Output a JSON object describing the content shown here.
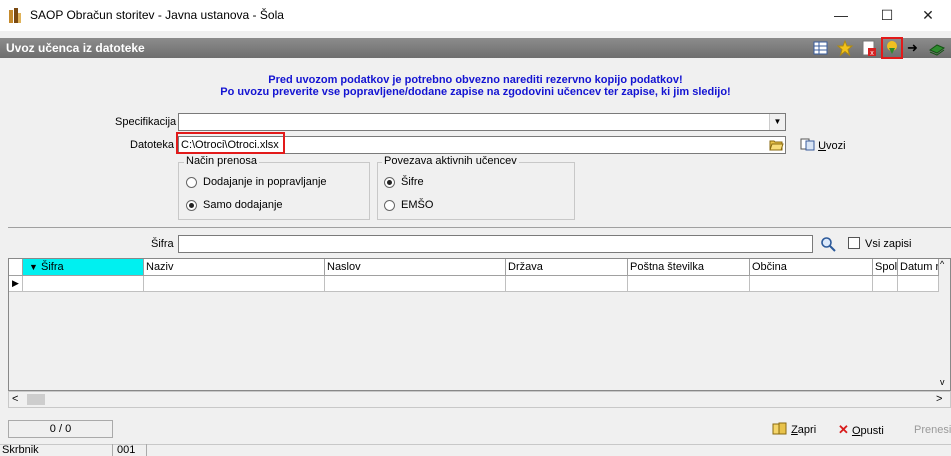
{
  "window": {
    "title": "SAOP Obračun storitev  - Javna ustanova - Šola",
    "minimize": "—",
    "maximize": "☐",
    "close": "✕"
  },
  "subheader": {
    "title": "Uvoz učenca iz datoteke",
    "toolbar_icons": [
      "grid-icon",
      "star-icon",
      "pdf-close-icon",
      "import-icon",
      "arrow-right-icon",
      "book-icon"
    ],
    "arrow_glyph": "➜"
  },
  "warning": {
    "line1": "Pred uvozom podatkov je potrebno obvezno narediti rezervno kopijo podatkov!",
    "line2": "Po uvozu preverite vse popravljene/dodane zapise na zgodovini učencev ter zapise, ki jim sledijo!"
  },
  "form": {
    "specifikacija_label": "Specifikacija",
    "specifikacija_value": "",
    "datoteka_label": "Datoteka",
    "datoteka_value": "C:\\Otroci\\Otroci.xlsx",
    "uvozi_prefix": "",
    "uvozi_underlined": "U",
    "uvozi_rest": "vozi"
  },
  "nacin_prenosa": {
    "title": "Način prenosa",
    "options": [
      {
        "label": "Dodajanje in popravljanje",
        "selected": false
      },
      {
        "label": "Samo dodajanje",
        "selected": true
      }
    ]
  },
  "povezava": {
    "title": "Povezava aktivnih učencev",
    "options": [
      {
        "label": "Šifre",
        "selected": true
      },
      {
        "label": "EMŠO",
        "selected": false
      }
    ]
  },
  "search": {
    "label": "Šifra",
    "value": "",
    "vsi_zapisi": "Vsi zapisi",
    "vsi_zapisi_checked": false
  },
  "grid": {
    "columns": [
      "Šifra",
      "Naziv",
      "Naslov",
      "Država",
      "Poštna številka",
      "Občina",
      "Spol",
      "Datum ro"
    ],
    "sort_glyph": "▼",
    "row_marker": "▶",
    "scroll_up": "^",
    "scroll_down": "v",
    "scroll_left": "<",
    "scroll_right": ">",
    "highlight_color": "#00f0f0"
  },
  "footer": {
    "counter": "0 / 0",
    "zapri_underlined": "Z",
    "zapri_rest": "apri",
    "opusti_underlined": "O",
    "opusti_rest": "pusti",
    "prenesi": "Prenesi"
  },
  "statusbar": {
    "user": "Skrbnik",
    "code": "001"
  }
}
